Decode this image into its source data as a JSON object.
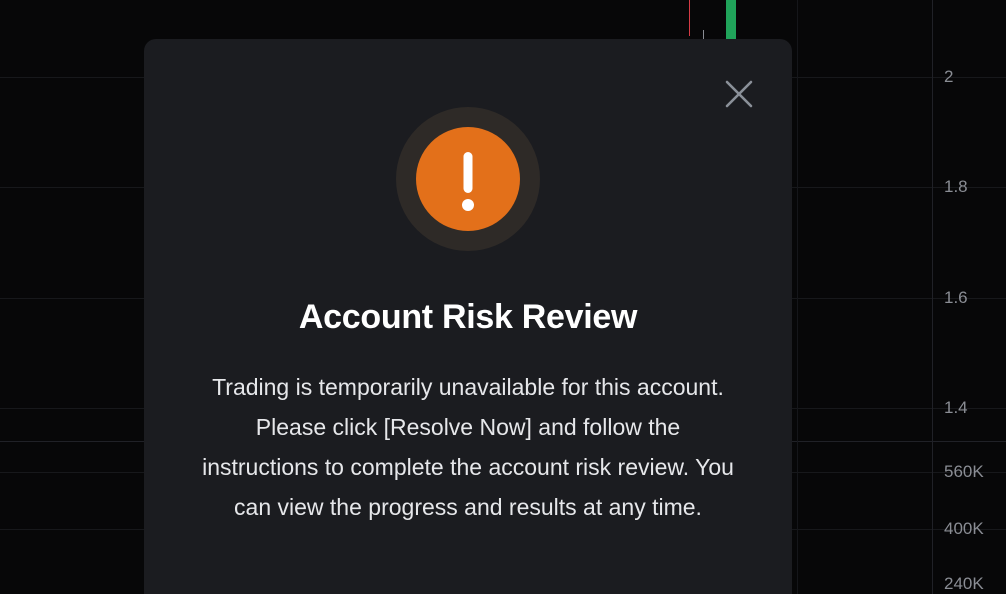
{
  "axis": {
    "labels": [
      "2",
      "1.8",
      "1.6",
      "1.4",
      "560K",
      "400K",
      "240K"
    ]
  },
  "dialog": {
    "title": "Account Risk Review",
    "message": "Trading is temporarily unavailable for this account. Please click [Resolve Now] and follow the instructions to complete the account risk review. You can view the progress and results at any time.",
    "close_icon": "close-icon",
    "status_icon": "warning-icon",
    "accent_color": "#e3701a"
  }
}
